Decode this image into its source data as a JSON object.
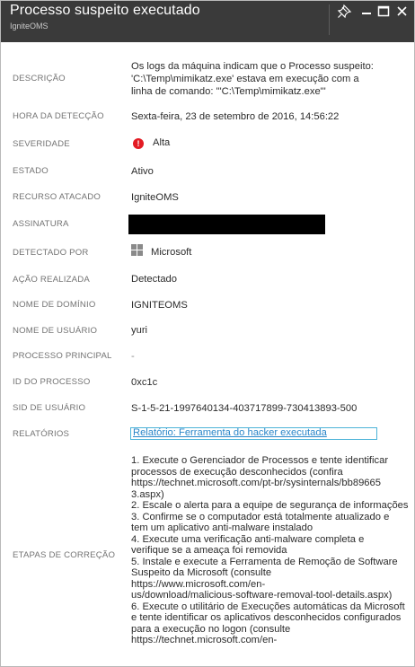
{
  "header": {
    "title": "Processo suspeito executado",
    "subtitle": "IgniteOMS",
    "buttons": [
      "pin-icon",
      "minimize-icon",
      "maximize-icon",
      "close-icon"
    ]
  },
  "fields": {
    "descricao": {
      "label": "DESCRIÇÃO",
      "lines": [
        "Os logs da máquina indicam que o Processo suspeito:",
        "'C:\\Temp\\mimikatz.exe' estava em execução com a",
        "linha de comando: '\"C:\\Temp\\mimikatz.exe\"'"
      ]
    },
    "hora": {
      "label": "HORA DA DETECÇÃO",
      "value": "Sexta-feira, 23 de setembro de 2016, 14:56:22"
    },
    "severidade": {
      "label": "SEVERIDADE",
      "value": "Alta",
      "icon": "!",
      "color": "#e31b23"
    },
    "estado": {
      "label": "ESTADO",
      "value": "Ativo"
    },
    "recurso": {
      "label": "RECURSO ATACADO",
      "value": "IgniteOMS"
    },
    "assinatura": {
      "label": "ASSINATURA"
    },
    "detectado": {
      "label": "DETECTADO POR",
      "value": "Microsoft"
    },
    "acao": {
      "label": "AÇÃO REALIZADA",
      "value": "Detectado"
    },
    "dominio": {
      "label": "NOME DE DOMÍNIO",
      "value": "IGNITEOMS"
    },
    "usuario": {
      "label": "NOME DE USUÁRIO",
      "value": "yuri"
    },
    "processo_principal": {
      "label": "PROCESSO PRINCIPAL",
      "value": "-"
    },
    "id_processo": {
      "label": "ID DO PROCESSO",
      "value": "0xc1c"
    },
    "sid": {
      "label": "SID DE USUÁRIO",
      "value": "S-1-5-21-1997640134-403717899-730413893-500"
    },
    "relatorios": {
      "label": "RELATÓRIOS",
      "link": "Relatório: Ferramenta do hacker executada"
    },
    "etapas": {
      "label": "ETAPAS DE CORREÇÃO",
      "lines": [
        "1. Execute o Gerenciador de Processos e tente identificar",
        "processos de execução desconhecidos (confira",
        "https://technet.microsoft.com/pt-br/sysinternals/bb89665",
        "3.aspx)",
        "2. Escale o alerta para a equipe de segurança de informações",
        "3. Confirme se o computador está totalmente atualizado e",
        "tem um aplicativo anti-malware instalado",
        "4. Execute uma verificação anti-malware completa e",
        "verifique se a ameaça foi removida",
        "5. Instale e execute a Ferramenta de Remoção de Software",
        "Suspeito da Microsoft (consulte",
        "https://www.microsoft.com/en-",
        "us/download/malicious-software-removal-tool-details.aspx)",
        "6. Execute o utilitário de Execuções automáticas da Microsoft",
        "e tente identificar os aplicativos desconhecidos configurados",
        "para a execução no logon (consulte",
        "https://technet.microsoft.com/en-"
      ]
    }
  },
  "colors": {
    "header_bg": "#3a3a3a",
    "label": "#737373",
    "link": "#2a86c9",
    "severity_high": "#e31b23"
  }
}
